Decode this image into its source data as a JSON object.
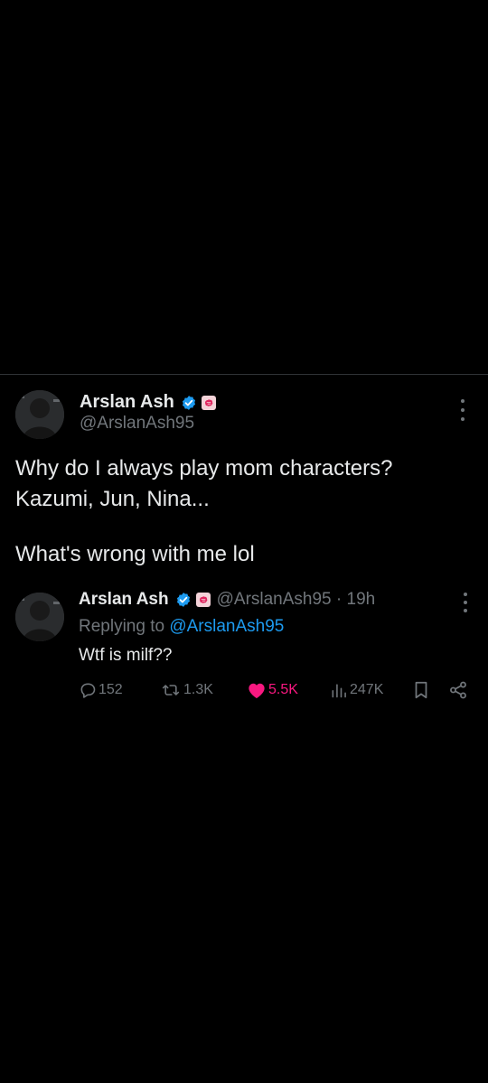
{
  "main_tweet": {
    "author_name": "Arslan Ash",
    "handle": "@ArslanAsh95",
    "text_lines": [
      "Why do I always play mom characters?",
      "Kazumi, Jun, Nina...",
      "What's wrong with me lol"
    ]
  },
  "reply_tweet": {
    "author_name": "Arslan Ash",
    "handle_time": "@ArslanAsh95 · 19h",
    "replying_prefix": "Replying to",
    "replying_handle": "@ArslanAsh95",
    "text": "Wtf is milf??",
    "actions": {
      "replies": "152",
      "retweets": "1.3K",
      "likes": "5.5K",
      "views": "247K"
    }
  },
  "icons": {
    "verified": "verified-badge-icon",
    "affiliate": "brain-badge-icon",
    "more": "more-vertical-icon",
    "reply": "reply-icon",
    "retweet": "retweet-icon",
    "like": "heart-icon",
    "views": "views-icon",
    "bookmark": "bookmark-icon",
    "share": "share-icon"
  },
  "colors": {
    "background": "#000000",
    "text_primary": "#e7e9ea",
    "text_secondary": "#71767b",
    "link": "#1d9bf0",
    "like_active": "#f91880",
    "divider": "#2f3336"
  }
}
